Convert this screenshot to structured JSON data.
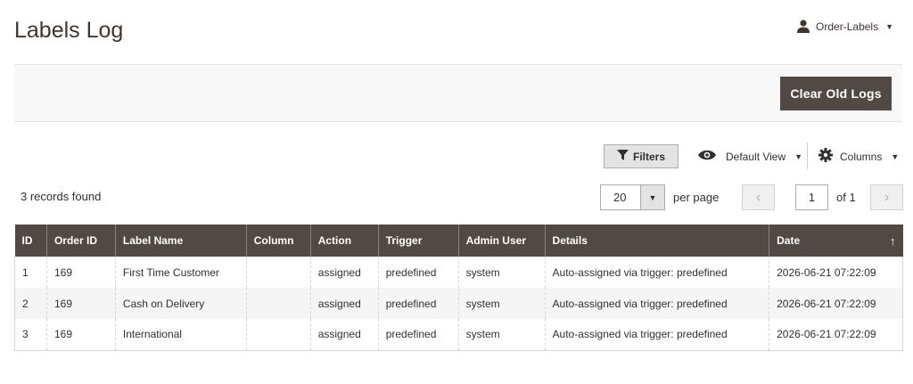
{
  "header": {
    "title": "Labels Log",
    "user": "Order-Labels"
  },
  "actions": {
    "clear_old_logs": "Clear Old Logs"
  },
  "toolbar": {
    "filters_label": "Filters",
    "view_label": "Default View",
    "columns_label": "Columns",
    "records_found": "3 records found",
    "per_page_value": "20",
    "per_page_label": "per page",
    "current_page": "1",
    "page_total": "of 1"
  },
  "table": {
    "columns": [
      "ID",
      "Order ID",
      "Label Name",
      "Column",
      "Action",
      "Trigger",
      "Admin User",
      "Details",
      "Date"
    ],
    "sorted_column": "Date",
    "sort_direction": "ascending",
    "rows": [
      {
        "id": "1",
        "order_id": "169",
        "label_name": "First Time Customer",
        "column": "",
        "action": "assigned",
        "trigger": "predefined",
        "admin_user": "system",
        "details": "Auto-assigned via trigger: predefined",
        "date": "2026-06-21 07:22:09"
      },
      {
        "id": "2",
        "order_id": "169",
        "label_name": "Cash on Delivery",
        "column": "",
        "action": "assigned",
        "trigger": "predefined",
        "admin_user": "system",
        "details": "Auto-assigned via trigger: predefined",
        "date": "2026-06-21 07:22:09"
      },
      {
        "id": "3",
        "order_id": "169",
        "label_name": "International",
        "column": "",
        "action": "assigned",
        "trigger": "predefined",
        "admin_user": "system",
        "details": "Auto-assigned via trigger: predefined",
        "date": "2026-06-21 07:22:09"
      }
    ]
  },
  "icons": {
    "user": "user-icon",
    "filter": "filter-icon",
    "view": "eye-icon",
    "columns": "gear-icon"
  },
  "colors": {
    "header_dark": "#514943",
    "title": "#41362f",
    "action_bar": "#f8f8f8"
  }
}
